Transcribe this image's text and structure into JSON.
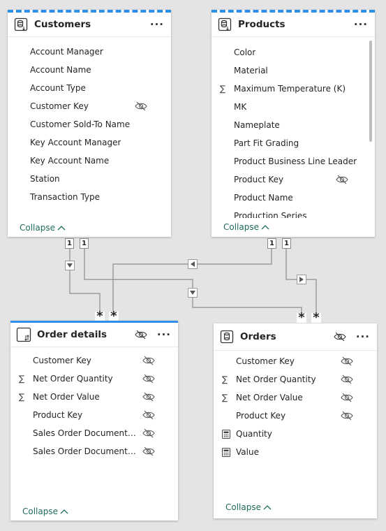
{
  "tables": {
    "customers": {
      "title": "Customers",
      "more": "···",
      "fields": [
        "Account Manager",
        "Account Name",
        "Account Type",
        "Customer Key",
        "Customer Sold-To Name",
        "Key Account Manager",
        "Key Account Name",
        "Station",
        "Transaction Type"
      ],
      "collapse": "Collapse"
    },
    "products": {
      "title": "Products",
      "more": "···",
      "fields": [
        "Color",
        "Material",
        "Maximum Temperature (K)",
        "MK",
        "Nameplate",
        "Part Fit Grading",
        "Product Business Line Leader",
        "Product Key",
        "Product Name",
        "Production Series"
      ],
      "collapse": "Collapse"
    },
    "order_details": {
      "title": "Order details",
      "more": "···",
      "fields": [
        "Customer Key",
        "Net Order Quantity",
        "Net Order Value",
        "Product Key",
        "Sales Order Document Lin...",
        "Sales Order Document Nu..."
      ],
      "collapse": "Collapse"
    },
    "orders": {
      "title": "Orders",
      "more": "···",
      "fields": [
        "Customer Key",
        "Net Order Quantity",
        "Net Order Value",
        "Product Key",
        "Quantity",
        "Value"
      ],
      "collapse": "Collapse"
    }
  },
  "relationships": {
    "one": "1",
    "many": "*",
    "sigma": "∑"
  }
}
